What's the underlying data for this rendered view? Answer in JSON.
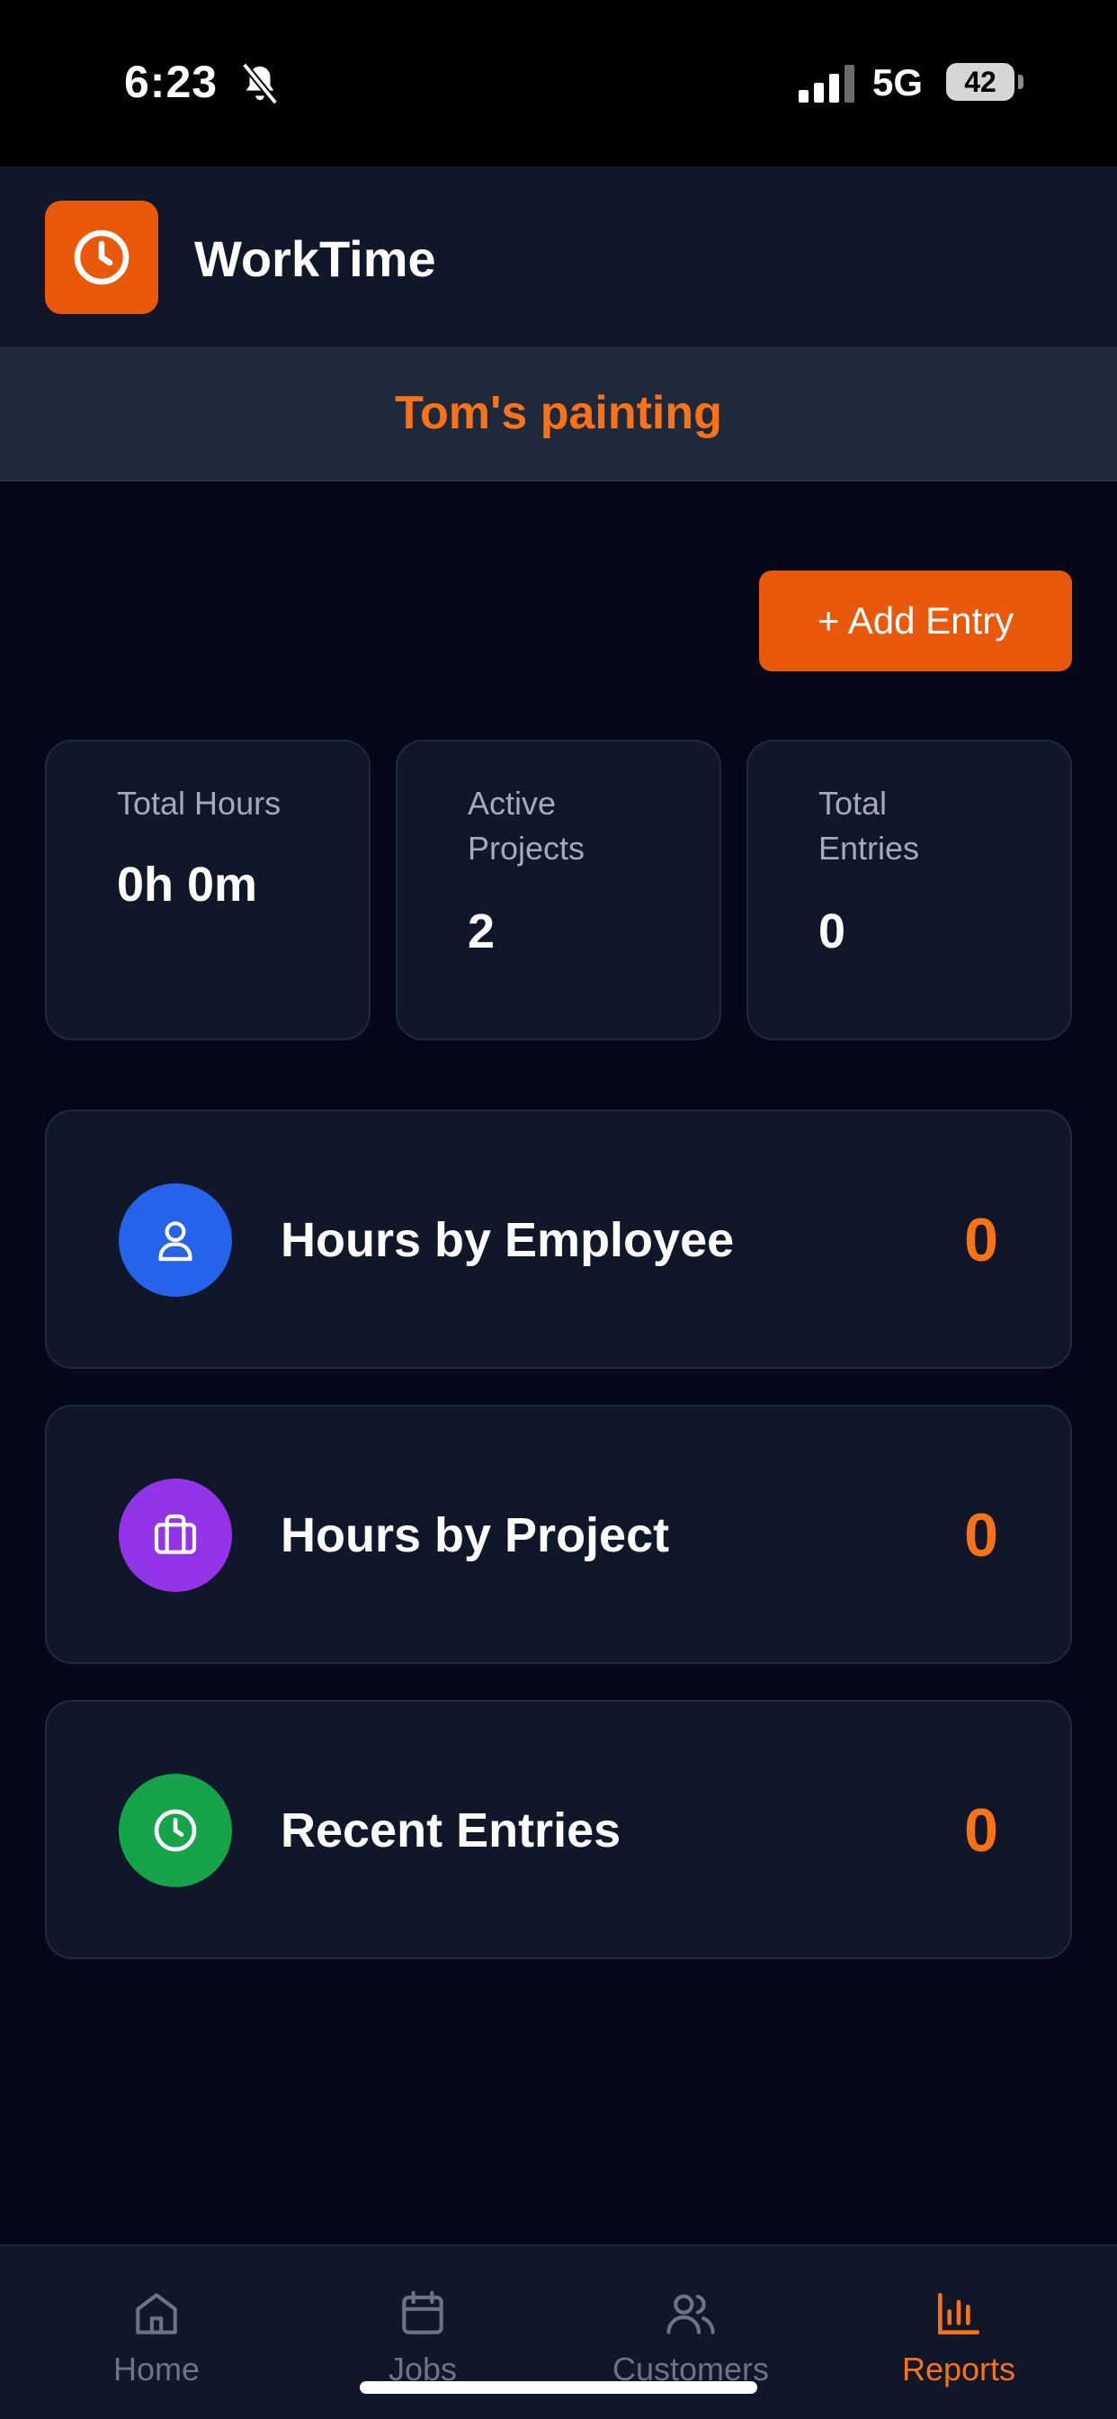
{
  "status_bar": {
    "time": "6:23",
    "network": "5G",
    "battery": "42"
  },
  "header": {
    "app_icon": "clock-icon",
    "title": "WorkTime"
  },
  "business": {
    "name": "Tom's painting"
  },
  "actions": {
    "add_entry_label": "+ Add Entry"
  },
  "stats": [
    {
      "label": "Total Hours",
      "value": "0h 0m"
    },
    {
      "label": "Active Projects",
      "value": "2"
    },
    {
      "label": "Total Entries",
      "value": "0"
    }
  ],
  "reports": [
    {
      "label": "Hours by Employee",
      "count": "0",
      "icon": "user-icon",
      "color": "#2563eb"
    },
    {
      "label": "Hours by Project",
      "count": "0",
      "icon": "briefcase-icon",
      "color": "#9333ea"
    },
    {
      "label": "Recent Entries",
      "count": "0",
      "icon": "clock-icon",
      "color": "#16a34a"
    }
  ],
  "tabs": [
    {
      "label": "Home",
      "icon": "home-icon",
      "active": false
    },
    {
      "label": "Jobs",
      "icon": "calendar-icon",
      "active": false
    },
    {
      "label": "Customers",
      "icon": "users-icon",
      "active": false
    },
    {
      "label": "Reports",
      "icon": "bar-chart-icon",
      "active": true
    }
  ],
  "colors": {
    "accent": "#ea580c",
    "accent_text": "#f97316",
    "background": "#040818",
    "card": "#0f1729"
  }
}
